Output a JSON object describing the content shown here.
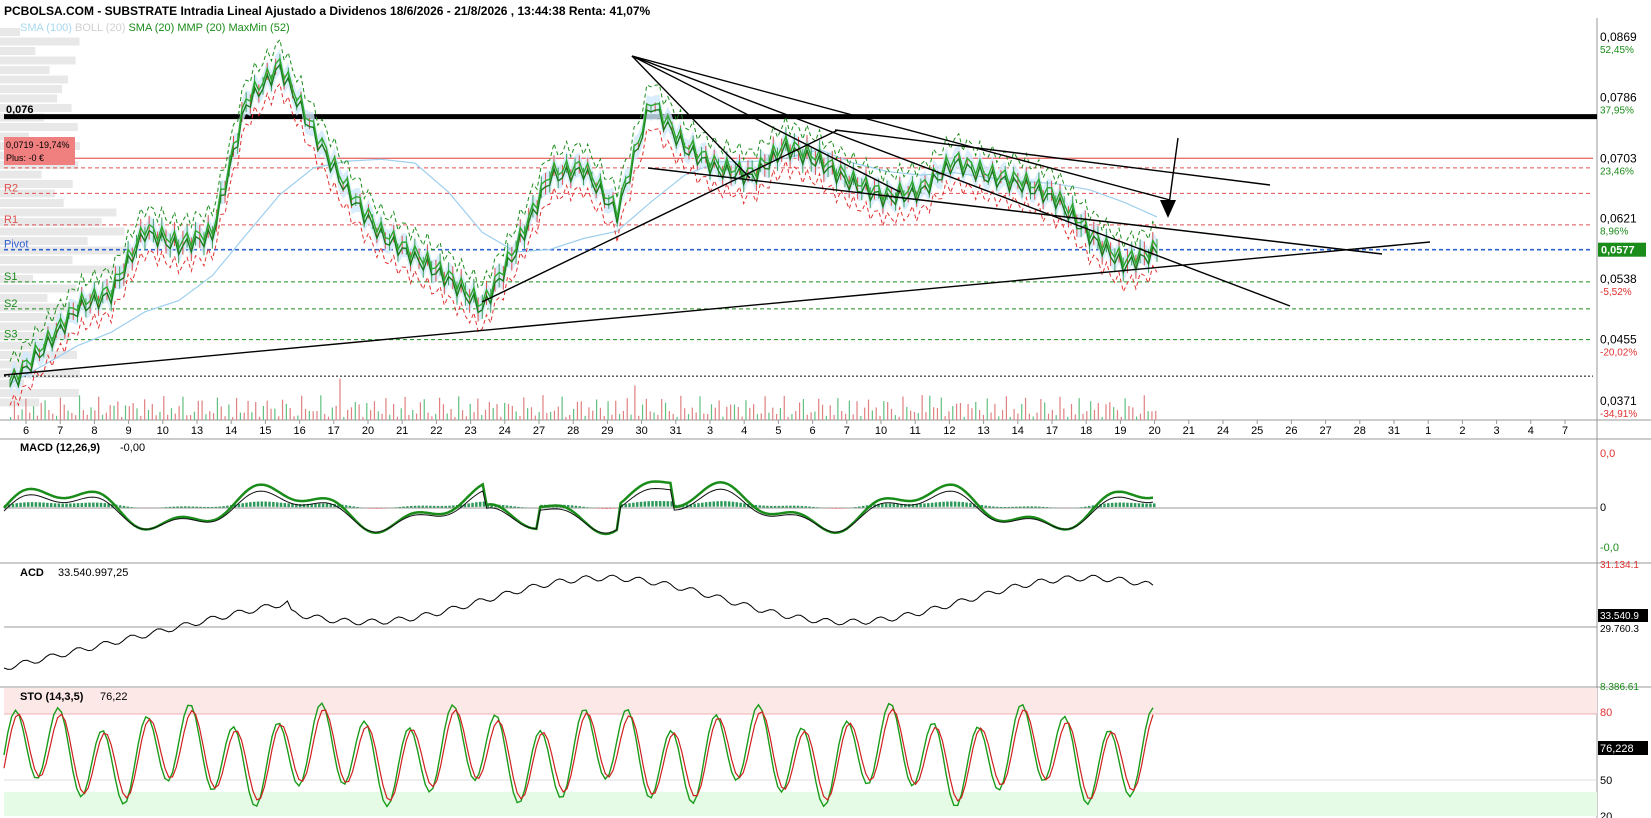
{
  "header": {
    "title": "PCBOLSA.COM - SUBSTRATE Intradia Lineal Ajustado a Dividenos 18/6/2026 - 21/8/2026 , 13:44:38 Renta: 41,07%",
    "legend": [
      {
        "text": "SMA (100)",
        "color": "#a8d8f0"
      },
      {
        "text": "BOLL (20)",
        "color": "#d0d0d0"
      },
      {
        "text": "SMA (20)",
        "color": "#1a8c1a"
      },
      {
        "text": "MMP (20)",
        "color": "#1a8c1a"
      },
      {
        "text": "MaxMin (52)",
        "color": "#1a8c1a"
      }
    ]
  },
  "price_panel": {
    "level_076": "0,076",
    "info_box_1": "0,0719 -19,74%",
    "info_box_2": "Plus: -0 €",
    "pivots": [
      {
        "label": "R2",
        "color": "#e05050",
        "value": 0.0655
      },
      {
        "label": "R1",
        "color": "#e05050",
        "value": 0.0612
      },
      {
        "label": "Pivot",
        "color": "#3060d0",
        "value": 0.0578
      },
      {
        "label": "S1",
        "color": "#1a8c1a",
        "value": 0.0534
      },
      {
        "label": "S2",
        "color": "#1a8c1a",
        "value": 0.0497
      },
      {
        "label": "S3",
        "color": "#1a8c1a",
        "value": 0.0455
      }
    ],
    "right_axis": [
      {
        "price": "0,0869",
        "pct": "52,45%",
        "color": "#1a8c1a",
        "value": 0.0869
      },
      {
        "price": "0,0786",
        "pct": "37,95%",
        "color": "#1a8c1a",
        "value": 0.0786
      },
      {
        "price": "0,0703",
        "pct": "23,46%",
        "color": "#1a8c1a",
        "value": 0.0703
      },
      {
        "price": "0,0621",
        "pct": "8,96%",
        "color": "#1a8c1a",
        "value": 0.0621
      },
      {
        "price": "0,0538",
        "pct": "-5,52%",
        "color": "#e03030",
        "value": 0.0538
      },
      {
        "price": "0,0455",
        "pct": "-20,02%",
        "color": "#e03030",
        "value": 0.0455
      },
      {
        "price": "0,0371",
        "pct": "-34,91%",
        "color": "#e03030",
        "value": 0.0371
      }
    ],
    "current_price": "0,0577",
    "current_color": "#1a8c1a"
  },
  "x_axis_labels": [
    "6",
    "7",
    "8",
    "9",
    "10",
    "13",
    "14",
    "15",
    "16",
    "17",
    "20",
    "21",
    "22",
    "23",
    "24",
    "27",
    "28",
    "29",
    "30",
    "31",
    "3",
    "4",
    "5",
    "6",
    "7",
    "10",
    "11",
    "12",
    "13",
    "14",
    "17",
    "18",
    "19",
    "20",
    "21",
    "24",
    "25",
    "26",
    "27",
    "28",
    "31",
    "1",
    "2",
    "3",
    "4",
    "7"
  ],
  "macd_panel": {
    "title": "MACD (12,26,9)",
    "value": "-0,00",
    "axis_top": "0,0",
    "axis_mid": "0",
    "axis_bottom": "-0,0"
  },
  "acd_panel": {
    "title": "ACD",
    "value": "33.540.997,25",
    "axis_top": "31.134.1",
    "axis_current": "33.540.9",
    "axis_mid": "29.760.3",
    "axis_bottom": "8.386.61"
  },
  "sto_panel": {
    "title": "STO (14,3,5)",
    "value": "76,22",
    "axis_current": "76,228",
    "axis_top": "80",
    "axis_mid": "50",
    "axis_bottom": "20"
  },
  "chart_data": {
    "type": "line",
    "x_dates": [
      "6",
      "7",
      "8",
      "9",
      "10",
      "13",
      "14",
      "15",
      "16",
      "17",
      "20",
      "21",
      "22",
      "23",
      "24",
      "27",
      "28",
      "29",
      "30",
      "31",
      "3",
      "4",
      "5",
      "6",
      "7",
      "10",
      "11",
      "12",
      "13",
      "14",
      "17",
      "18",
      "19",
      "20",
      "21"
    ],
    "close": [
      0.0395,
      0.0445,
      0.05,
      0.052,
      0.0605,
      0.0585,
      0.06,
      0.078,
      0.083,
      0.074,
      0.066,
      0.06,
      0.057,
      0.054,
      0.05,
      0.058,
      0.068,
      0.069,
      0.063,
      0.078,
      0.072,
      0.069,
      0.068,
      0.072,
      0.07,
      0.067,
      0.065,
      0.066,
      0.07,
      0.068,
      0.067,
      0.065,
      0.06,
      0.056,
      0.0577
    ],
    "ylim": [
      0.0345,
      0.0895
    ],
    "resistance_level": 0.076
  }
}
